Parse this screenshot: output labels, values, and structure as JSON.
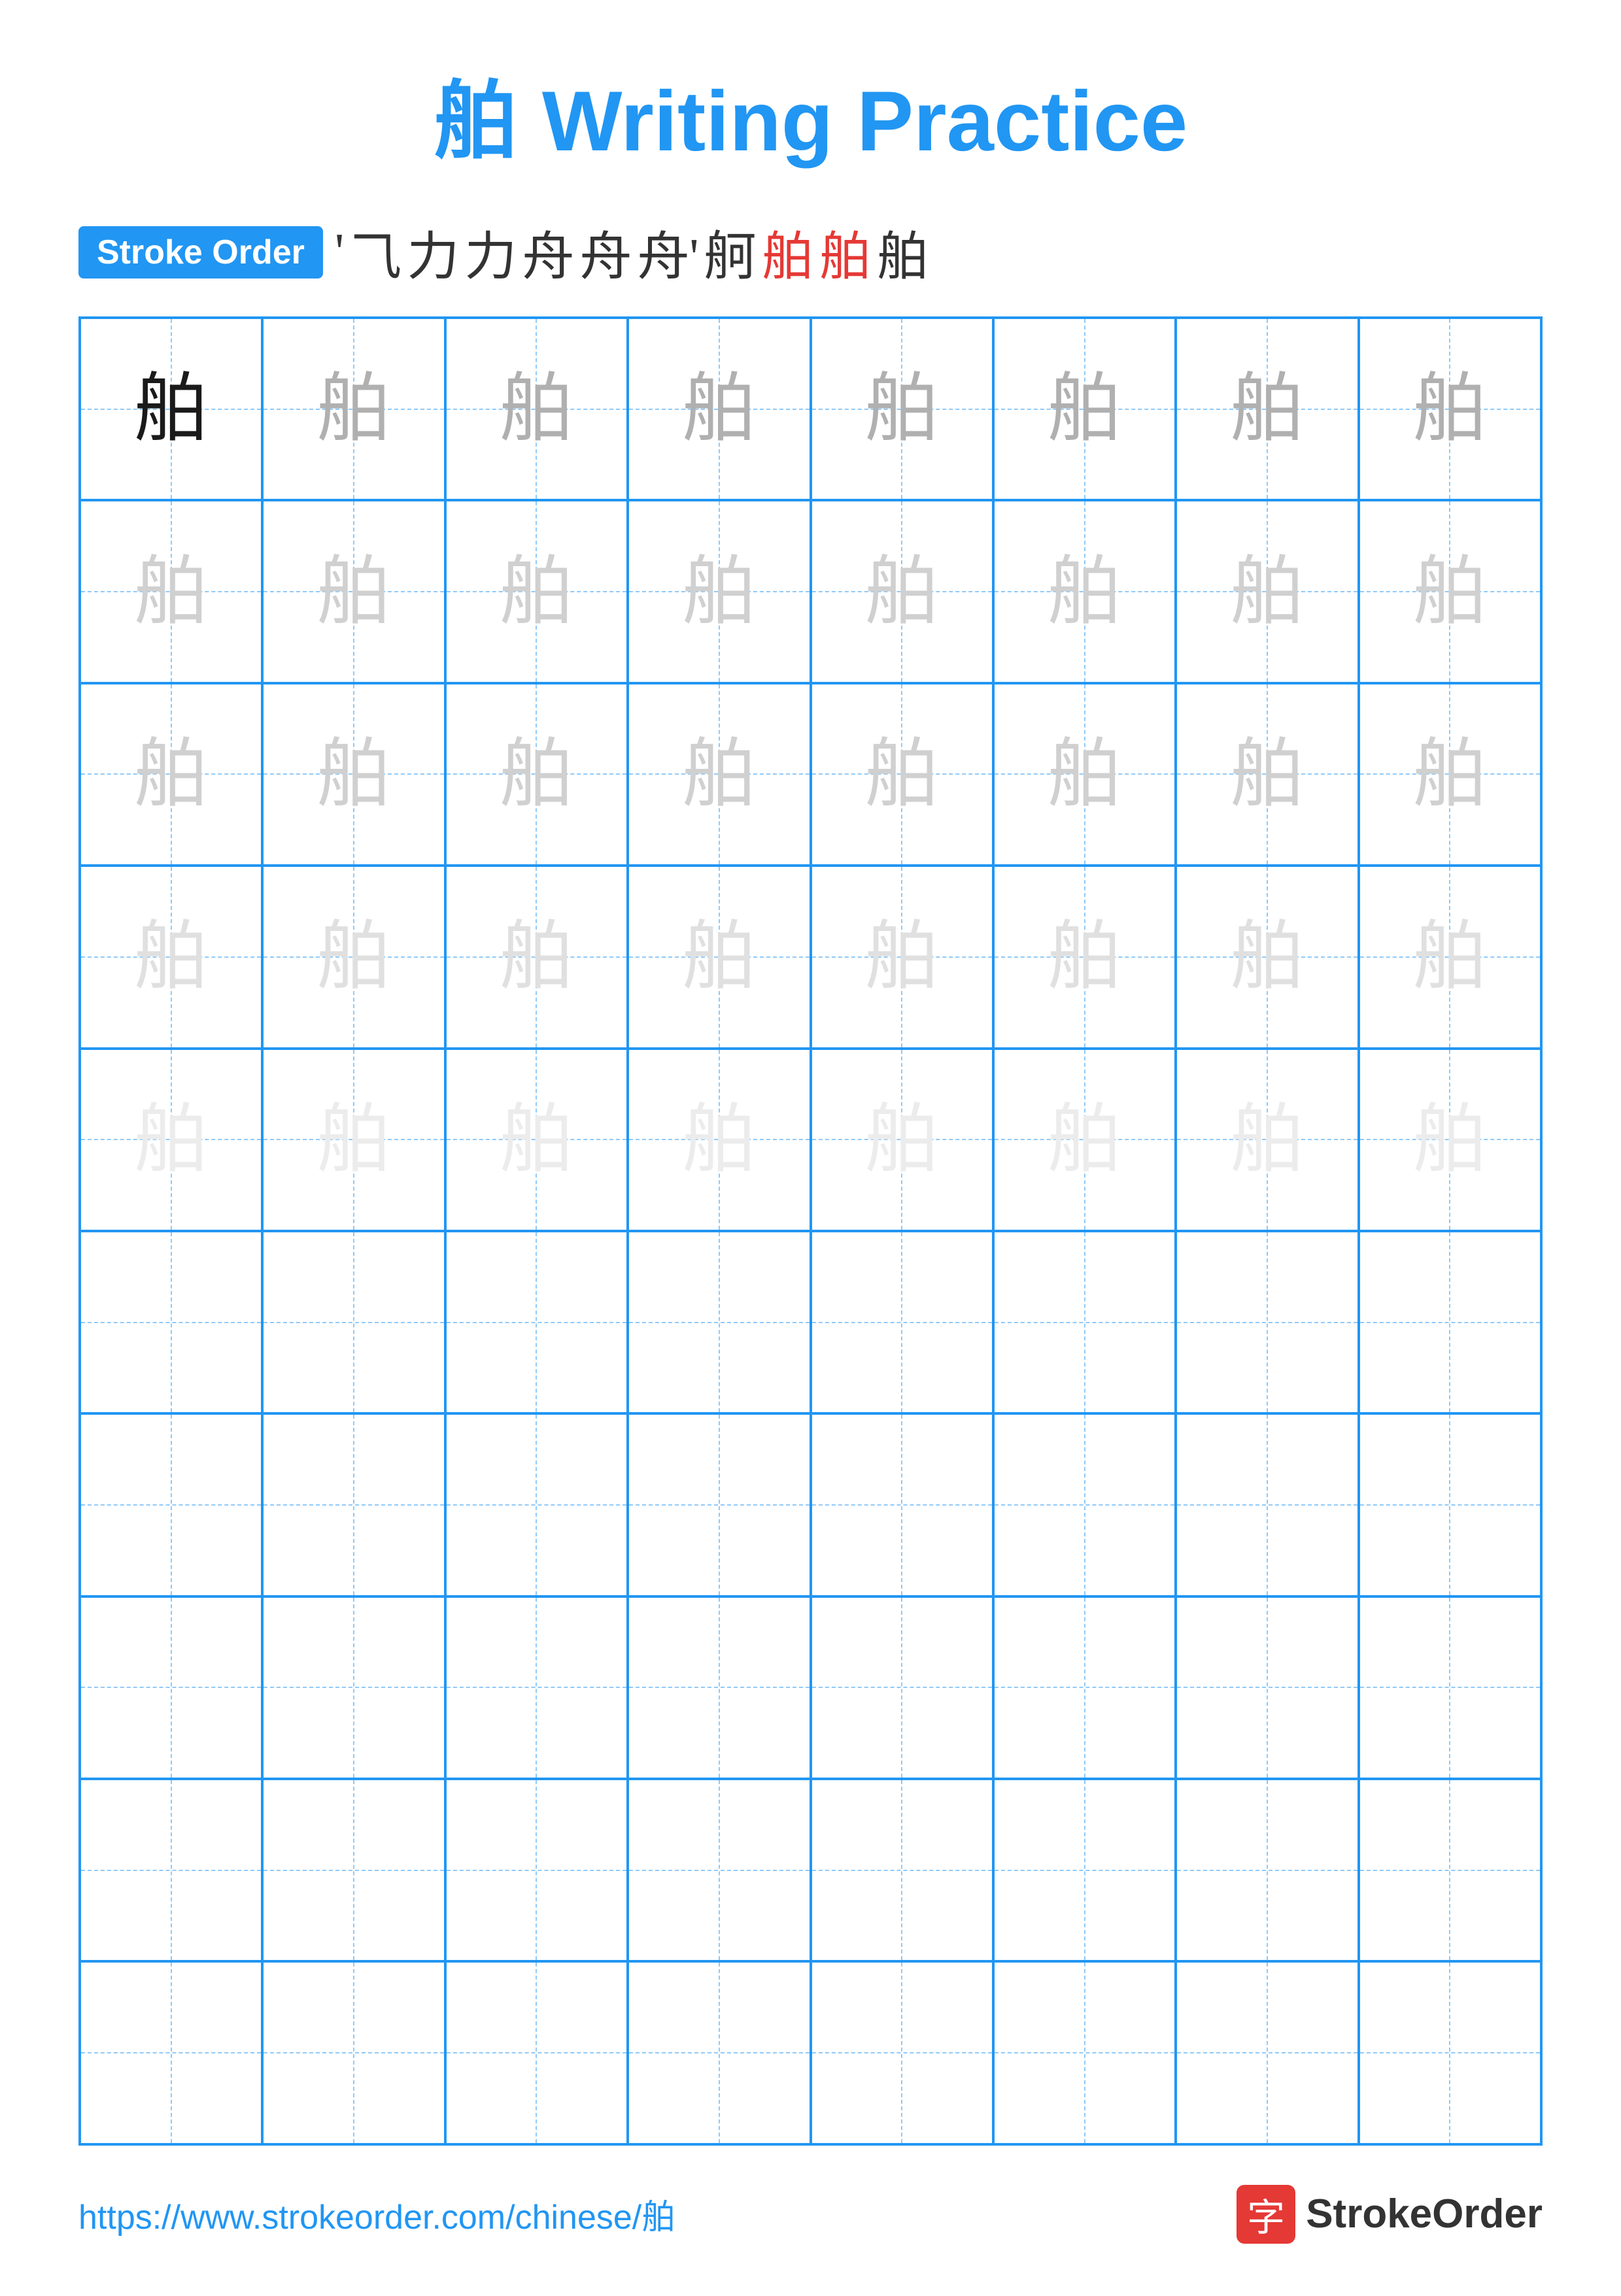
{
  "title": "舶 Writing Practice",
  "stroke_order_label": "Stroke Order",
  "stroke_sequence": [
    "'",
    "⺄",
    "力",
    "力",
    "舟",
    "舟",
    "舟'",
    "舸",
    "舶",
    "舶",
    "舶"
  ],
  "stroke_sequence_colors": [
    "dark",
    "dark",
    "dark",
    "dark",
    "dark",
    "dark",
    "dark",
    "dark",
    "red",
    "red",
    "dark"
  ],
  "character": "舶",
  "grid": {
    "rows": 10,
    "cols": 8,
    "filled_rows": [
      {
        "cells": [
          {
            "char": "舶",
            "shade": "dark"
          },
          {
            "char": "舶",
            "shade": "medium-gray"
          },
          {
            "char": "舶",
            "shade": "medium-gray"
          },
          {
            "char": "舶",
            "shade": "medium-gray"
          },
          {
            "char": "舶",
            "shade": "medium-gray"
          },
          {
            "char": "舶",
            "shade": "medium-gray"
          },
          {
            "char": "舶",
            "shade": "medium-gray"
          },
          {
            "char": "舶",
            "shade": "medium-gray"
          }
        ]
      },
      {
        "cells": [
          {
            "char": "舶",
            "shade": "light-gray"
          },
          {
            "char": "舶",
            "shade": "light-gray"
          },
          {
            "char": "舶",
            "shade": "light-gray"
          },
          {
            "char": "舶",
            "shade": "light-gray"
          },
          {
            "char": "舶",
            "shade": "light-gray"
          },
          {
            "char": "舶",
            "shade": "light-gray"
          },
          {
            "char": "舶",
            "shade": "light-gray"
          },
          {
            "char": "舶",
            "shade": "light-gray"
          }
        ]
      },
      {
        "cells": [
          {
            "char": "舶",
            "shade": "light-gray"
          },
          {
            "char": "舶",
            "shade": "light-gray"
          },
          {
            "char": "舶",
            "shade": "light-gray"
          },
          {
            "char": "舶",
            "shade": "light-gray"
          },
          {
            "char": "舶",
            "shade": "light-gray"
          },
          {
            "char": "舶",
            "shade": "light-gray"
          },
          {
            "char": "舶",
            "shade": "light-gray"
          },
          {
            "char": "舶",
            "shade": "light-gray"
          }
        ]
      },
      {
        "cells": [
          {
            "char": "舶",
            "shade": "very-light-gray"
          },
          {
            "char": "舶",
            "shade": "very-light-gray"
          },
          {
            "char": "舶",
            "shade": "very-light-gray"
          },
          {
            "char": "舶",
            "shade": "very-light-gray"
          },
          {
            "char": "舶",
            "shade": "very-light-gray"
          },
          {
            "char": "舶",
            "shade": "very-light-gray"
          },
          {
            "char": "舶",
            "shade": "very-light-gray"
          },
          {
            "char": "舶",
            "shade": "very-light-gray"
          }
        ]
      },
      {
        "cells": [
          {
            "char": "舶",
            "shade": "ultra-light"
          },
          {
            "char": "舶",
            "shade": "ultra-light"
          },
          {
            "char": "舶",
            "shade": "ultra-light"
          },
          {
            "char": "舶",
            "shade": "ultra-light"
          },
          {
            "char": "舶",
            "shade": "ultra-light"
          },
          {
            "char": "舶",
            "shade": "ultra-light"
          },
          {
            "char": "舶",
            "shade": "ultra-light"
          },
          {
            "char": "舶",
            "shade": "ultra-light"
          }
        ]
      }
    ],
    "empty_rows": 5
  },
  "footer": {
    "url": "https://www.strokeorder.com/chinese/舶",
    "logo_char": "字",
    "logo_text": "StrokeOrder"
  }
}
